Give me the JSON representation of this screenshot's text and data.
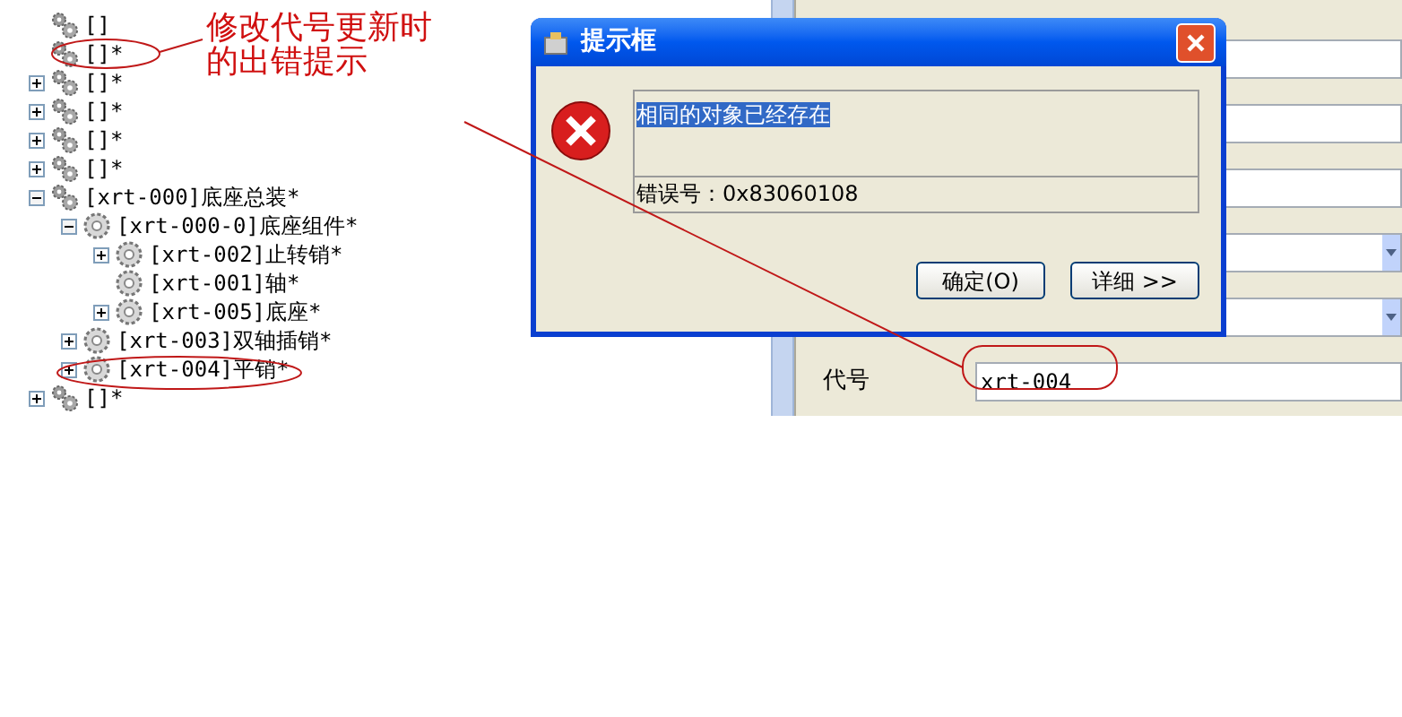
{
  "tree": [
    {
      "label": "[]",
      "kind": "assembly",
      "leaf": true
    },
    {
      "label": "[]*",
      "kind": "assembly",
      "leaf": true
    },
    {
      "label": "[]*",
      "kind": "assembly",
      "leaf": false,
      "expanded": false
    },
    {
      "label": "[]*",
      "kind": "assembly",
      "leaf": false,
      "expanded": false
    },
    {
      "label": "[]*",
      "kind": "assembly",
      "leaf": false,
      "expanded": false
    },
    {
      "label": "[]*",
      "kind": "assembly",
      "leaf": false,
      "expanded": false
    },
    {
      "label": "[xrt-000]底座总装*",
      "kind": "assembly",
      "leaf": false,
      "expanded": true,
      "children": [
        {
          "label": "[xrt-000-0]底座组件*",
          "kind": "part",
          "leaf": false,
          "expanded": true,
          "children": [
            {
              "label": "[xrt-002]止转销*",
              "kind": "part",
              "leaf": false,
              "expanded": false
            },
            {
              "label": "[xrt-001]轴*",
              "kind": "part",
              "leaf": true
            },
            {
              "label": "[xrt-005]底座*",
              "kind": "part",
              "leaf": false,
              "expanded": false
            }
          ]
        },
        {
          "label": "[xrt-003]双轴插销*",
          "kind": "part",
          "leaf": false,
          "expanded": false
        },
        {
          "label": "[xrt-004]平销*",
          "kind": "part",
          "leaf": false,
          "expanded": false
        }
      ]
    },
    {
      "label": "[]*",
      "kind": "assembly",
      "leaf": false,
      "expanded": false
    }
  ],
  "form": {
    "fields": [
      {
        "kind": "text"
      },
      {
        "kind": "text"
      },
      {
        "kind": "text"
      },
      {
        "kind": "combo"
      },
      {
        "kind": "combo"
      },
      {
        "kind": "text",
        "label": "代号",
        "value": "xrt-004"
      }
    ]
  },
  "dialog": {
    "title": "提示框",
    "message": "相同的对象已经存在",
    "error_code": "错误号：0x83060108",
    "buttons": [
      "确定(O)",
      "详细 >>"
    ]
  },
  "annotation": {
    "lines": [
      "修改代号更新时",
      "的出错提示"
    ]
  }
}
